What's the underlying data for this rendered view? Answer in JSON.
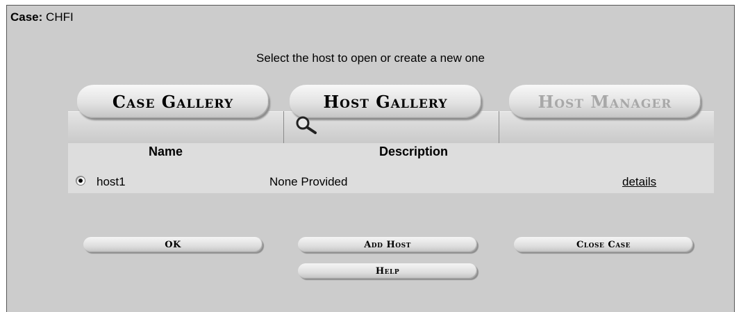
{
  "case": {
    "label": "Case:",
    "name": "CHFI"
  },
  "instructions": "Select the host to open or create a new one",
  "tabs": [
    {
      "label": "Case Gallery",
      "state": "normal"
    },
    {
      "label": "Host Gallery",
      "state": "active"
    },
    {
      "label": "Host Manager",
      "state": "disabled"
    }
  ],
  "active_tab_icon": "magnifier-icon",
  "table": {
    "columns": [
      "Name",
      "Description"
    ],
    "rows": [
      {
        "selected": true,
        "name": "host1",
        "description": "None Provided",
        "link": "details"
      }
    ]
  },
  "buttons": {
    "ok": "OK",
    "add_host": "Add Host",
    "close_case": "Close Case",
    "help": "Help"
  },
  "colors": {
    "panel_bg": "#cccccc",
    "list_bg": "#dddddd",
    "disabled_text": "#a8a8a8"
  }
}
